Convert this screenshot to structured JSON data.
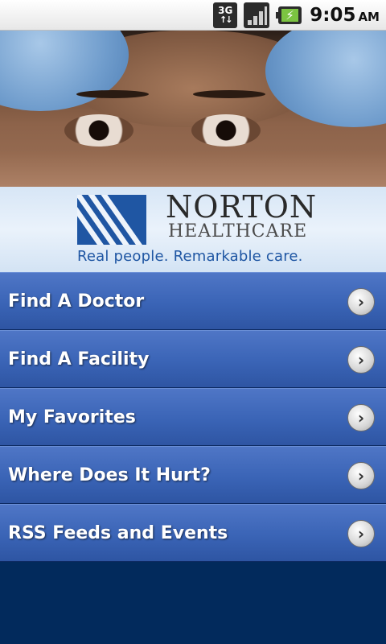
{
  "status_bar": {
    "network_type": "3G",
    "network_activity_icon": "up-down-arrows-icon",
    "signal_icon": "signal-strength-icon",
    "battery_icon": "battery-charging-icon",
    "time": "9:05",
    "ampm": "AM"
  },
  "banner": {
    "brand_name": "NORTON",
    "brand_sub": "HEALTHCARE",
    "tagline": "Real people. Remarkable care.",
    "logo_icon": "norton-logo-mark"
  },
  "menu": {
    "items": [
      {
        "label": "Find A Doctor",
        "icon": "chevron-right-icon"
      },
      {
        "label": "Find A Facility",
        "icon": "chevron-right-icon"
      },
      {
        "label": "My Favorites",
        "icon": "chevron-right-icon"
      },
      {
        "label": "Where Does It Hurt?",
        "icon": "chevron-right-icon"
      },
      {
        "label": "RSS Feeds and Events",
        "icon": "chevron-right-icon"
      }
    ]
  },
  "colors": {
    "menu_blue": "#3a64b6",
    "background_navy": "#022a5c",
    "brand_blue": "#1f56a3"
  }
}
